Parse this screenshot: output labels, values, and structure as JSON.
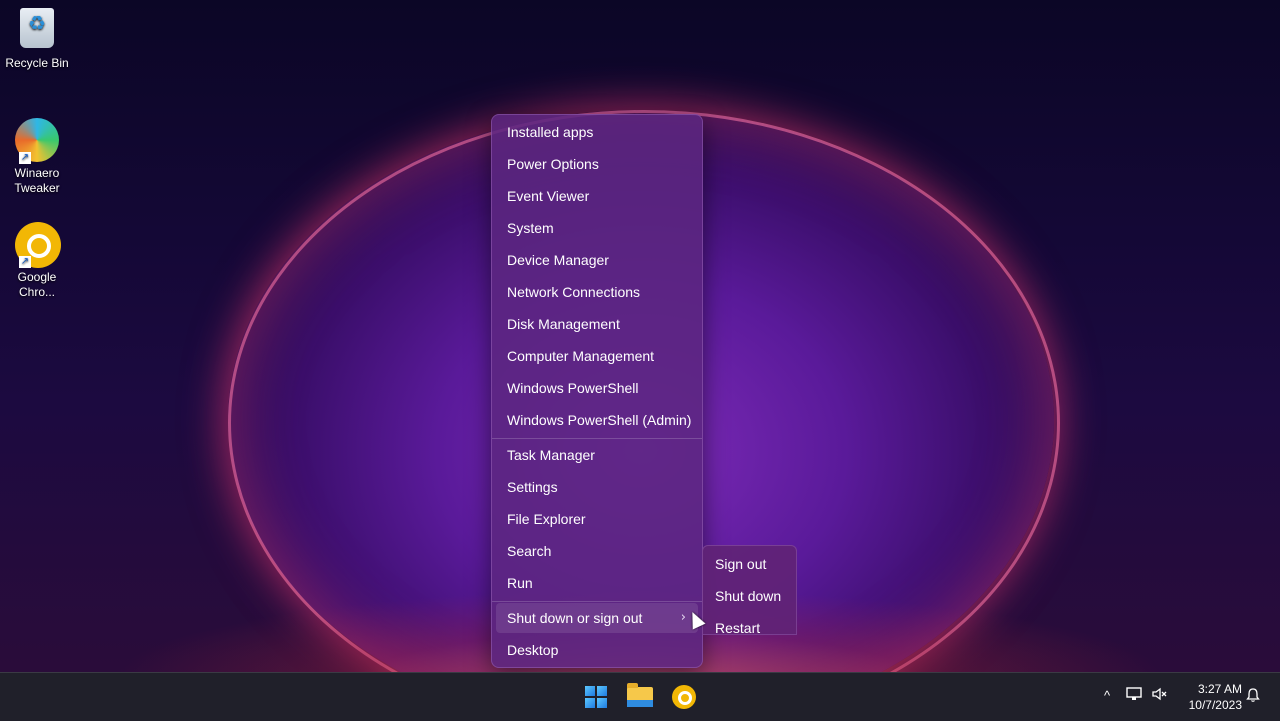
{
  "desktop": {
    "icons": [
      {
        "label": "Recycle Bin",
        "icon": "recycle-bin-icon"
      },
      {
        "label": "Winaero\nTweaker",
        "icon": "winaero-tweaker-icon"
      },
      {
        "label": "Google\nChro...",
        "icon": "google-chrome-icon"
      }
    ]
  },
  "context_menu": {
    "items": [
      {
        "label": "Installed apps"
      },
      {
        "label": "Power Options"
      },
      {
        "label": "Event Viewer"
      },
      {
        "label": "System"
      },
      {
        "label": "Device Manager"
      },
      {
        "label": "Network Connections"
      },
      {
        "label": "Disk Management"
      },
      {
        "label": "Computer Management"
      },
      {
        "label": "Windows PowerShell"
      },
      {
        "label": "Windows PowerShell (Admin)"
      },
      {
        "label": "Task Manager"
      },
      {
        "label": "Settings"
      },
      {
        "label": "File Explorer"
      },
      {
        "label": "Search"
      },
      {
        "label": "Run"
      },
      {
        "label": "Shut down or sign out",
        "has_submenu": true,
        "chevron": "›"
      },
      {
        "label": "Desktop"
      }
    ]
  },
  "submenu": {
    "items": [
      {
        "label": "Sign out"
      },
      {
        "label": "Shut down"
      },
      {
        "label": "Restart"
      }
    ]
  },
  "taskbar": {
    "pinned": [
      "start-icon",
      "file-explorer-icon",
      "google-chrome-icon"
    ],
    "tray": {
      "chevron": "^",
      "time": "3:27 AM",
      "date": "10/7/2023"
    }
  },
  "colors": {
    "menu_bg": "#5c2680",
    "taskbar_bg": "#20202a",
    "accent": "#1f7be0"
  }
}
